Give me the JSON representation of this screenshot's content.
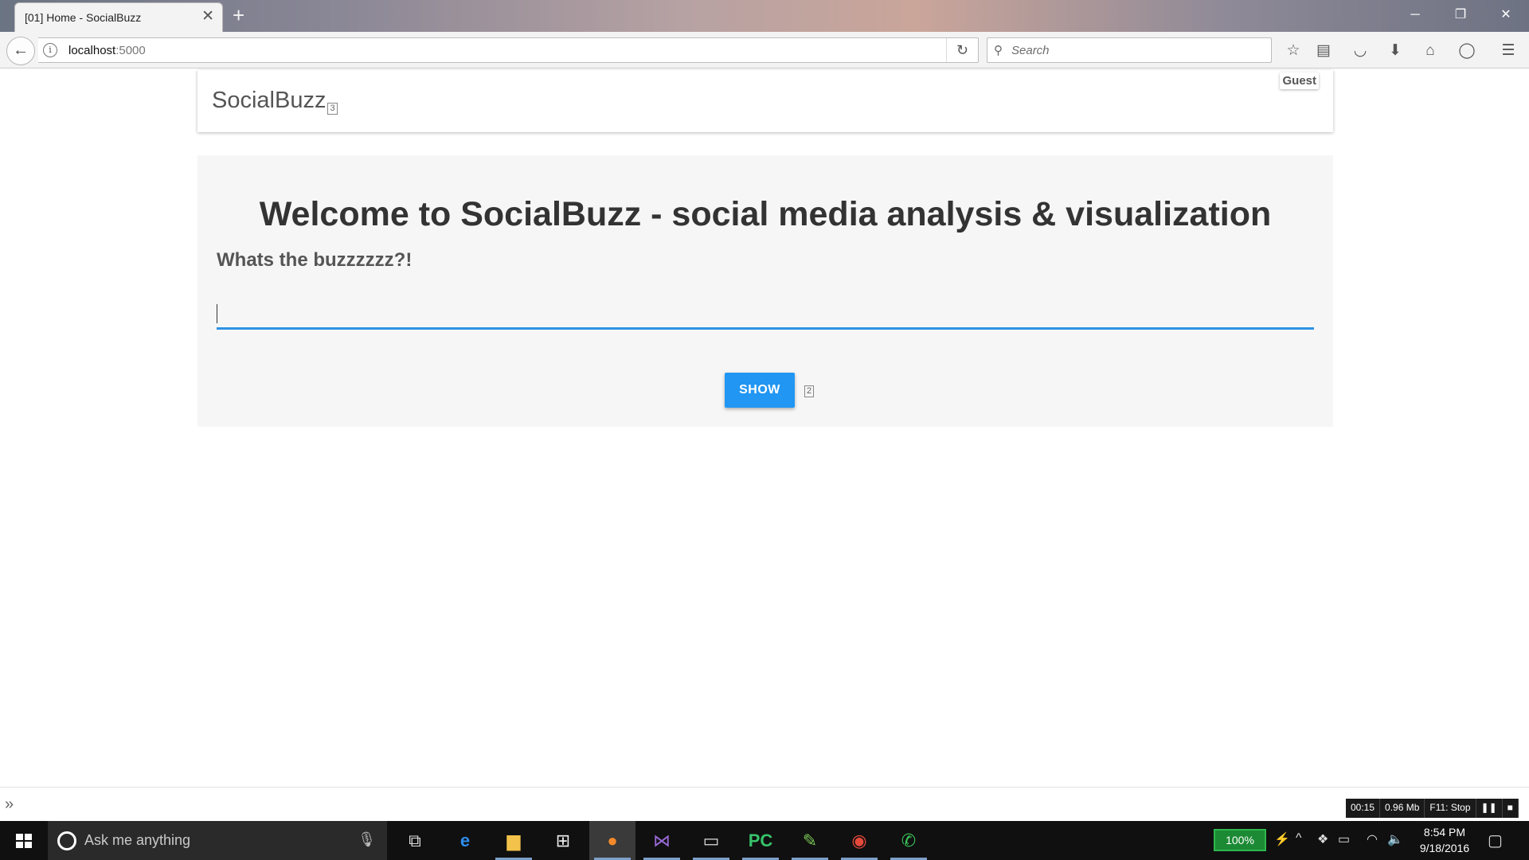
{
  "browser": {
    "tab_title": "[01] Home - SocialBuzz",
    "tab_close": "✕",
    "new_tab": "+",
    "url_host": "localhost",
    "url_port": ":5000",
    "search_placeholder": "Search",
    "window_controls": [
      "minimize",
      "restore",
      "close"
    ]
  },
  "app": {
    "brand": "SocialBuzz",
    "brand_badge": "3",
    "user_label": "Guest"
  },
  "hero": {
    "title": "Welcome to SocialBuzz - social media analysis & visualization",
    "subtitle": "Whats the buzzzzzz?!",
    "input_value": "",
    "show_button": "SHOW",
    "show_badge": "2"
  },
  "recorder": {
    "time": "00:15",
    "size": "0.96 Mb",
    "stop_hint": "F11: Stop"
  },
  "taskbar": {
    "cortana_placeholder": "Ask me anything",
    "battery": "100%",
    "time": "8:54 PM",
    "date": "9/18/2016",
    "apps": [
      "task-view",
      "edge",
      "file-explorer",
      "store",
      "firefox",
      "visual-studio",
      "terminal",
      "pycharm",
      "notepad",
      "chrome",
      "whatsapp"
    ]
  },
  "colors": {
    "accent": "#2196f3",
    "input_underline": "#2d93e6",
    "hero_bg": "#f6f6f6"
  }
}
